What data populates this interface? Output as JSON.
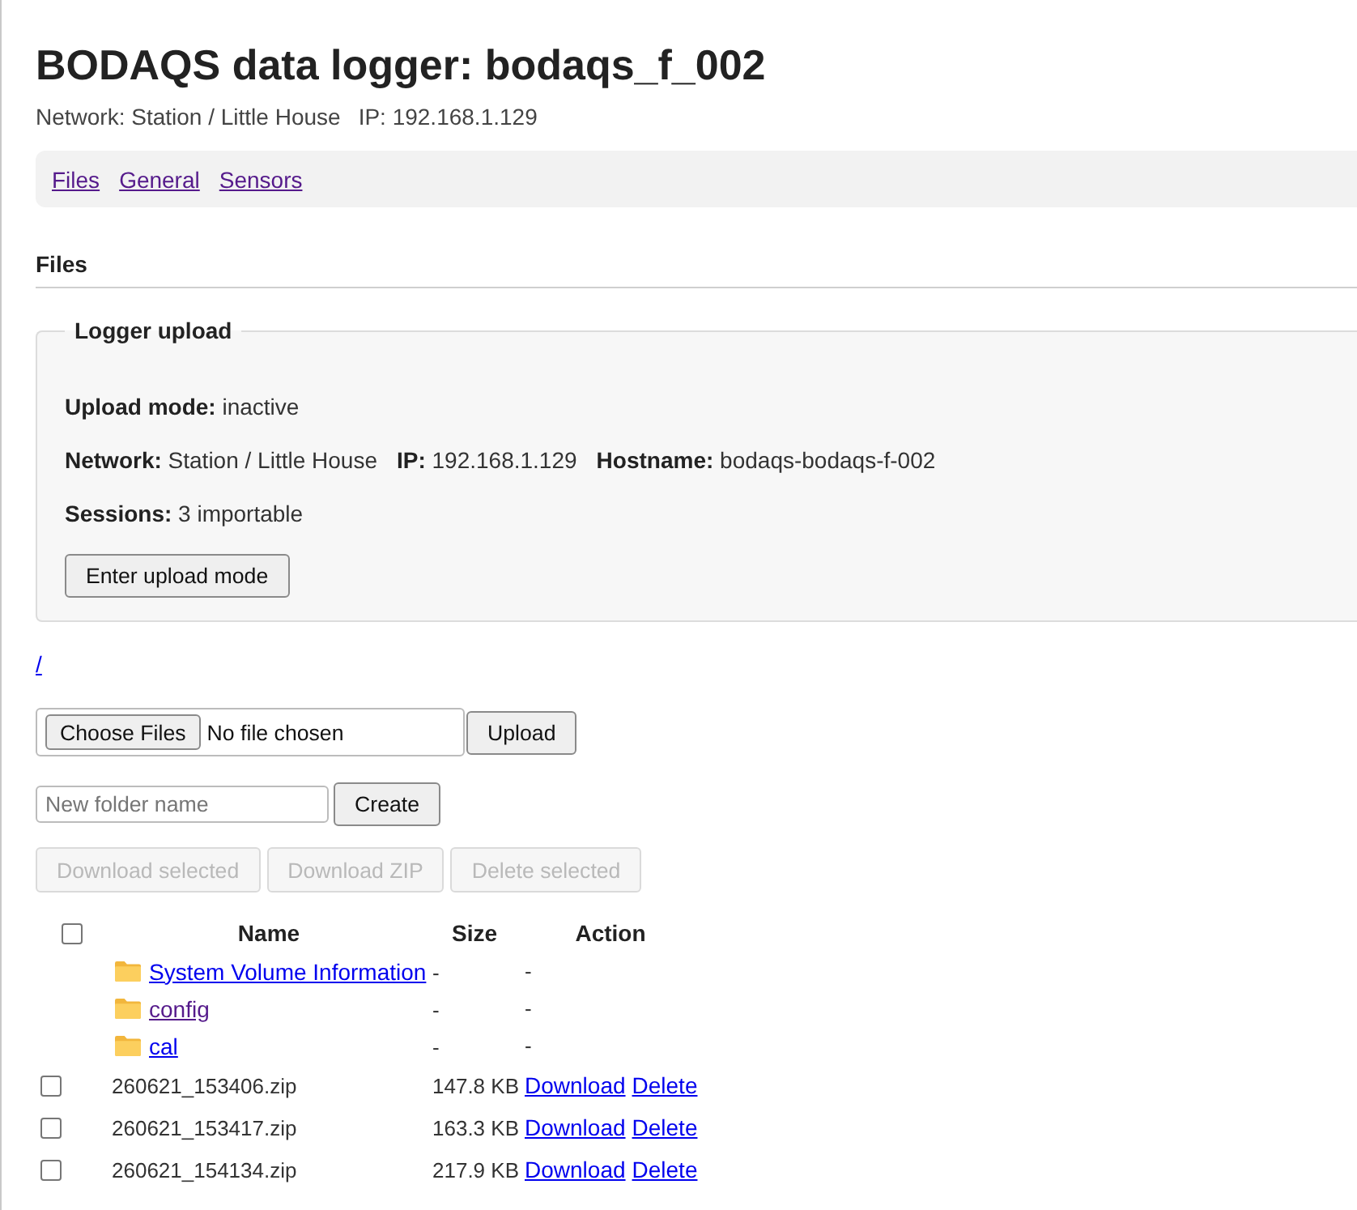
{
  "header": {
    "title": "BODAQS data logger: bodaqs_f_002",
    "info": [
      "Network: Station / Little House",
      "IP: 192.168.1.129"
    ]
  },
  "nav": [
    {
      "label": "Files",
      "visited": true
    },
    {
      "label": "General",
      "visited": true
    },
    {
      "label": "Sensors",
      "visited": true
    }
  ],
  "section_title": "Files",
  "upload_panel": {
    "legend": "Logger upload",
    "lines": [
      [
        "**Upload mode:** inactive"
      ],
      [
        "**Network:** Station / Little House",
        "**IP:** 192.168.1.129",
        "**Hostname:** bodaqs-bodaqs-f-002"
      ],
      [
        "**Sessions:** 3 importable"
      ]
    ],
    "button": "Enter upload mode"
  },
  "path_link": {
    "label": "/",
    "visited": false
  },
  "file_upload": {
    "choose_button": "Choose Files",
    "status": "No file chosen",
    "submit_button": "Upload"
  },
  "new_folder": {
    "placeholder": "New folder name",
    "button": "Create"
  },
  "bulk_actions": [
    {
      "label": "Download selected",
      "disabled": true
    },
    {
      "label": "Download ZIP",
      "disabled": true
    },
    {
      "label": "Delete selected",
      "disabled": true
    }
  ],
  "table": {
    "select_all": {
      "checked": false
    },
    "columns": [
      "Name",
      "Size",
      "Action"
    ],
    "rows": [
      {
        "kind": "folder",
        "name": "System Volume Information",
        "visited": false,
        "size": "-",
        "action": "-"
      },
      {
        "kind": "folder",
        "name": "config",
        "visited": true,
        "size": "-",
        "action": "-"
      },
      {
        "kind": "folder",
        "name": "cal",
        "visited": false,
        "size": "-",
        "action": "-"
      },
      {
        "kind": "file",
        "name": "260621_153406.zip",
        "checked": false,
        "size": "147.8 KB",
        "actions": [
          "Download",
          "Delete"
        ]
      },
      {
        "kind": "file",
        "name": "260621_153417.zip",
        "checked": false,
        "size": "163.3 KB",
        "actions": [
          "Download",
          "Delete"
        ]
      },
      {
        "kind": "file",
        "name": "260621_154134.zip",
        "checked": false,
        "size": "217.9 KB",
        "actions": [
          "Download",
          "Delete"
        ]
      }
    ]
  }
}
